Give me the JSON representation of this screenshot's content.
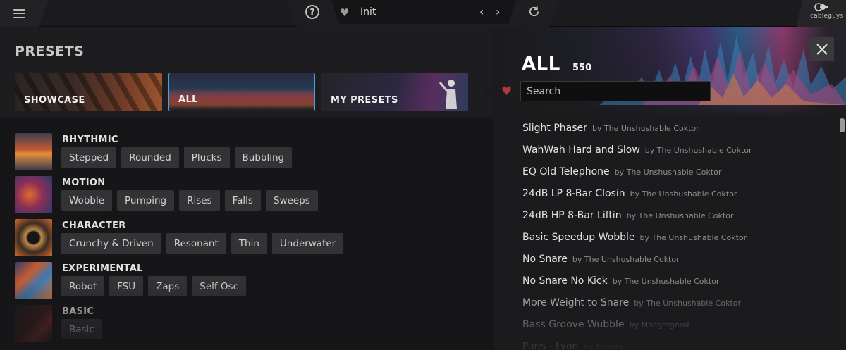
{
  "topbar": {
    "menu_icon": "hamburger-menu-icon",
    "help_icon": "question-circle-icon",
    "favorite_icon": "heart-icon",
    "current_preset": "Init",
    "prev_icon": "chevron-left-icon",
    "next_icon": "chevron-right-icon",
    "prev_glyph": "‹",
    "next_glyph": "›",
    "help_glyph": "?",
    "reload_icon": "reload-icon",
    "brand": "cableguys"
  },
  "left": {
    "title": "PRESETS",
    "tabs": [
      {
        "label": "SHOWCASE",
        "selected": false
      },
      {
        "label": "ALL",
        "selected": true
      },
      {
        "label": "MY PRESETS",
        "selected": false
      }
    ],
    "categories": [
      {
        "name": "RHYTHMIC",
        "tags": [
          "Stepped",
          "Rounded",
          "Plucks",
          "Bubbling"
        ]
      },
      {
        "name": "MOTION",
        "tags": [
          "Wobble",
          "Pumping",
          "Rises",
          "Falls",
          "Sweeps"
        ]
      },
      {
        "name": "CHARACTER",
        "tags": [
          "Crunchy & Driven",
          "Resonant",
          "Thin",
          "Underwater"
        ]
      },
      {
        "name": "EXPERIMENTAL",
        "tags": [
          "Robot",
          "FSU",
          "Zaps",
          "Self Osc"
        ]
      },
      {
        "name": "BASIC",
        "tags": [
          "Basic"
        ]
      }
    ]
  },
  "right": {
    "title": "ALL",
    "count": "550",
    "search_placeholder": "Search",
    "favorite_filter_icon": "heart-icon",
    "close_icon": "close-icon",
    "presets": [
      {
        "name": "Slight Phaser",
        "author": "by The Unshushable Coktor"
      },
      {
        "name": "WahWah Hard and Slow",
        "author": "by The Unshushable Coktor"
      },
      {
        "name": "EQ Old Telephone",
        "author": "by The Unshushable Coktor"
      },
      {
        "name": "24dB LP 8-Bar Closin",
        "author": "by The Unshushable Coktor"
      },
      {
        "name": "24dB HP 8-Bar Liftin",
        "author": "by The Unshushable Coktor"
      },
      {
        "name": "Basic Speedup Wobble",
        "author": "by The Unshushable Coktor"
      },
      {
        "name": "No Snare",
        "author": "by The Unshushable Coktor"
      },
      {
        "name": "No Snare No Kick",
        "author": "by The Unshushable Coktor"
      },
      {
        "name": "More Weight to Snare",
        "author": "by The Unshushable Coktor"
      },
      {
        "name": "Bass Groove Wubble",
        "author": "by Macgregoroi"
      },
      {
        "name": "Paris - Lyon",
        "author": "by Kopeak"
      }
    ]
  },
  "colors": {
    "accent_blue": "#4aa3e0",
    "heart_red": "#b23a3a"
  }
}
